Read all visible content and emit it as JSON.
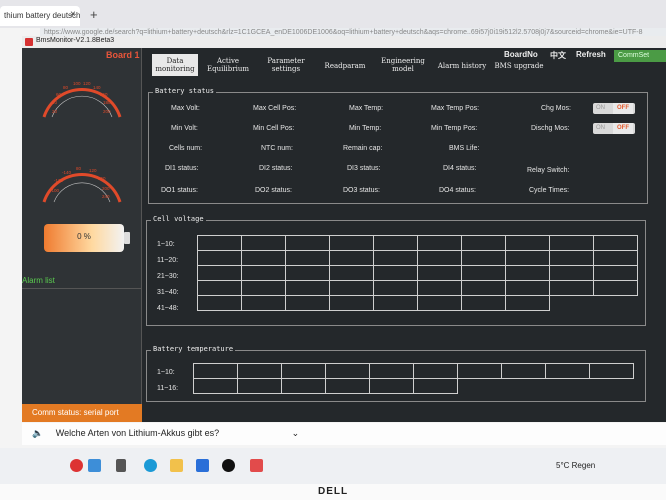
{
  "browser": {
    "tab_title": "thium battery deutsch",
    "tab_close": "×",
    "new_tab": "+",
    "address": "https://www.google.de/search?q=lithium+battery+deutsch&rlz=1C1GCEA_enDE1006DE1006&oq=lithium+battery+deutsch&aqs=chrome..69i57j0i19i512l2.5708j0j7&sourceid=chrome&ie=UTF-8"
  },
  "window": {
    "title": "BmsMonitor-V2.1.8Beta3"
  },
  "left": {
    "board": "Board 1",
    "gauge1_ticks": [
      "20",
      "40",
      "60",
      "80",
      "100",
      "120",
      "140",
      "160",
      "180",
      "200"
    ],
    "gauge2_ticks": [
      "-100",
      "-120",
      "-140",
      "80",
      "120",
      "160",
      "200",
      "240"
    ],
    "battery_percent": "0 %",
    "alarm_title": "Alarm list",
    "comm_status": "Comm status: serial port"
  },
  "menu": [
    {
      "label": "Data monitoring",
      "l1": "Data",
      "l2": "monitoring"
    },
    {
      "label": "Active Equilibrium",
      "l1": "Active",
      "l2": "Equilibrium"
    },
    {
      "label": "Parameter settings",
      "l1": "Parameter",
      "l2": "settings"
    },
    {
      "label": "Readparam",
      "l1": "Readparam",
      "l2": ""
    },
    {
      "label": "Engineering model",
      "l1": "Engineering",
      "l2": "model"
    },
    {
      "label": "Alarm history",
      "l1": "Alarm history",
      "l2": ""
    },
    {
      "label": "BMS upgrade",
      "l1": "BMS upgrade",
      "l2": ""
    }
  ],
  "topbar": {
    "boardno": "BoardNo",
    "lang": "中文",
    "refresh": "Refresh",
    "commset": "CommSet"
  },
  "battery_status": {
    "title": "Battery status",
    "labels": {
      "max_volt": "Max Volt:",
      "max_cell_pos": "Max Cell Pos:",
      "max_temp": "Max Temp:",
      "max_temp_pos": "Max Temp Pos:",
      "min_volt": "Min Volt:",
      "min_cell_pos": "Min Cell Pos:",
      "min_temp": "Min Temp:",
      "min_temp_pos": "Min Temp Pos:",
      "cells_num": "Cells num:",
      "ntc_num": "NTC num:",
      "remain_cap": "Remain cap:",
      "bms_life": "BMS Life:",
      "di1": "DI1 status:",
      "di2": "DI2 status:",
      "di3": "DI3 status:",
      "di4": "DI4 status:",
      "do1": "DO1 status:",
      "do2": "DO2 status:",
      "do3": "DO3 status:",
      "do4": "DO4 status:",
      "chg_mos": "Chg Mos:",
      "dischg_mos": "Dischg Mos:",
      "relay_switch": "Relay Switch:",
      "cycle_times": "Cycle Times:"
    },
    "toggle_on": "ON",
    "toggle_off": "OFF"
  },
  "cell_voltage": {
    "title": "Cell voltage",
    "rows": [
      "1~10:",
      "11~20:",
      "21~30:",
      "31~40:",
      "41~48:"
    ]
  },
  "battery_temperature": {
    "title": "Battery temperature",
    "rows": [
      "1~10:",
      "11~16:"
    ]
  },
  "notification": {
    "text": "Welche Arten von Lithium-Akkus gibt es?",
    "chevron": "⌄"
  },
  "taskbar": {
    "weather": "5°C  Regen"
  },
  "brand": "DELL"
}
